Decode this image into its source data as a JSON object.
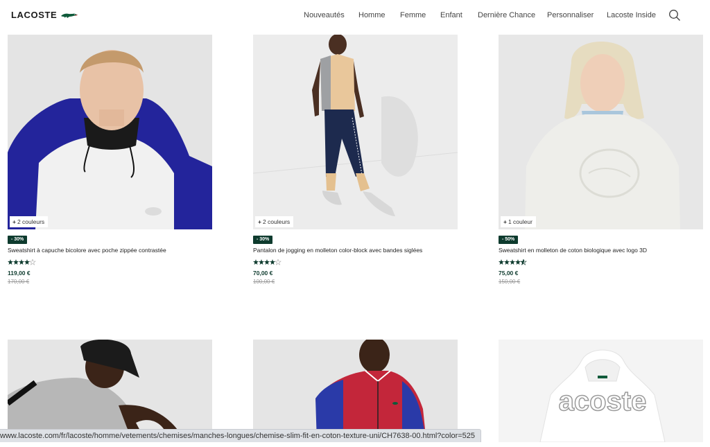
{
  "header": {
    "logo_text": "LACOSTE",
    "nav": [
      "Nouveautés",
      "Homme",
      "Femme",
      "Enfant",
      "Dernière Chance",
      "Personnaliser",
      "Lacoste Inside"
    ]
  },
  "products": [
    {
      "swatch": "2 couleurs",
      "promo": "- 30%",
      "title": "Sweatshirt à capuche bicolore avec poche zippée contrastée",
      "rating": 4,
      "price": "119,00 €",
      "old_price": "170,00 €"
    },
    {
      "swatch": "2 couleurs",
      "promo": "- 30%",
      "title": "Pantalon de jogging en molleton color-block avec bandes siglées",
      "rating": 4,
      "price": "70,00 €",
      "old_price": "100,00 €"
    },
    {
      "swatch": "1 couleur",
      "promo": "- 50%",
      "title": "Sweatshirt en molleton de coton biologique avec logo 3D",
      "rating": 4.5,
      "price": "75,00 €",
      "old_price": "150,00 €"
    }
  ],
  "second_row": [
    {
      "image": "man-black-cap-grey-tshirt"
    },
    {
      "image": "man-red-blue-track-jacket"
    },
    {
      "image": "white-hoodie-lacoste-print",
      "print_text": "acoste"
    }
  ],
  "status_bar": {
    "url": "www.lacoste.com/fr/lacoste/homme/vetements/chemises/manches-longues/chemise-slim-fit-en-coton-texture-uni/CH7638-00.html?color=525"
  },
  "colors": {
    "brand_green": "#0e3b2e",
    "star_green": "#0e3b2e",
    "image_bg": "#e9e9e9"
  }
}
